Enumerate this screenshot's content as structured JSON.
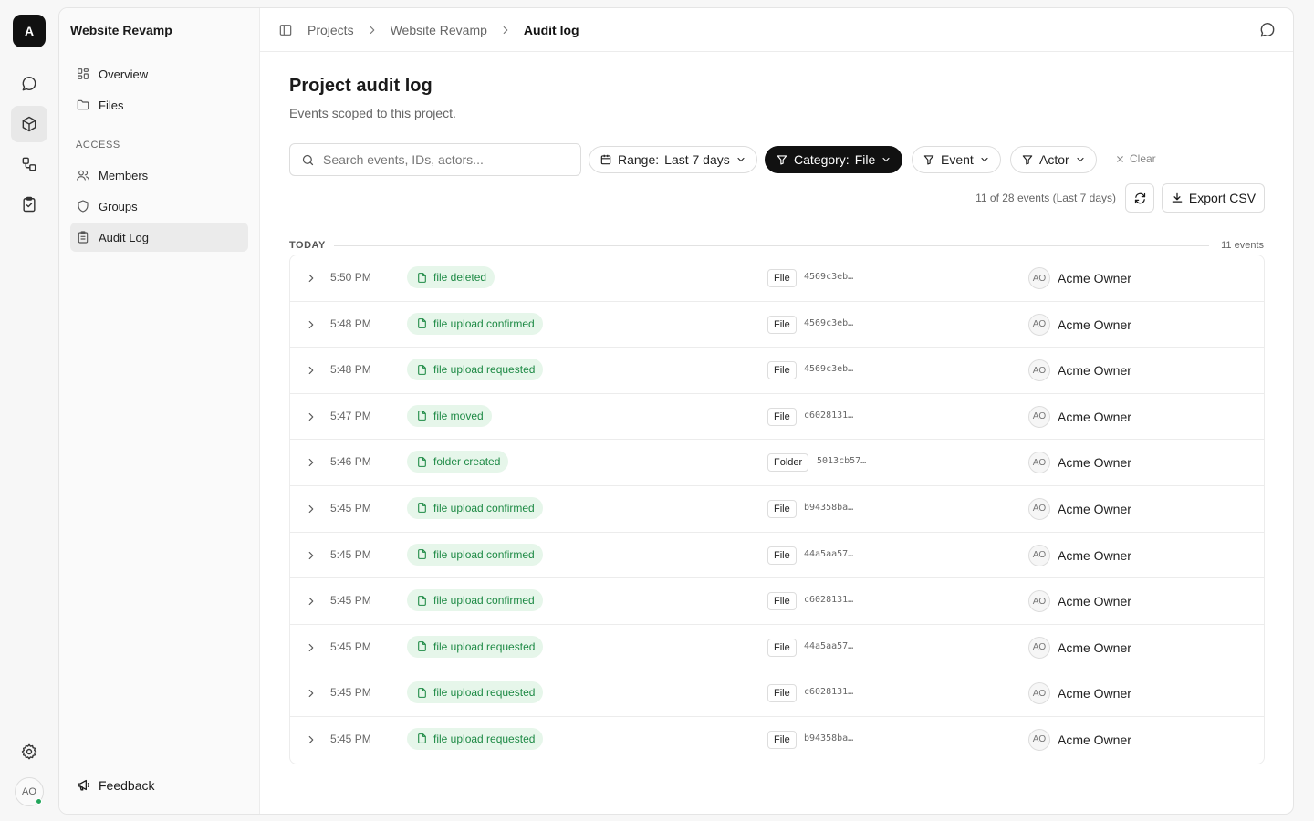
{
  "workspace": {
    "initial": "A"
  },
  "user": {
    "initials": "AO"
  },
  "sidebar": {
    "project_title": "Website Revamp",
    "items": [
      {
        "label": "Overview",
        "icon": "grid-icon"
      },
      {
        "label": "Files",
        "icon": "folder-icon"
      }
    ],
    "section_label": "ACCESS",
    "access_items": [
      {
        "label": "Members",
        "icon": "users-icon"
      },
      {
        "label": "Groups",
        "icon": "shield-icon"
      },
      {
        "label": "Audit Log",
        "icon": "clipboard-icon",
        "active": true
      }
    ],
    "feedback_label": "Feedback"
  },
  "breadcrumb": {
    "items": [
      "Projects",
      "Website Revamp"
    ],
    "current": "Audit log"
  },
  "page": {
    "title": "Project audit log",
    "subtitle": "Events scoped to this project."
  },
  "filters": {
    "search_placeholder": "Search events, IDs, actors...",
    "range": {
      "label": "Range:",
      "value": "Last 7 days"
    },
    "category": {
      "label": "Category:",
      "value": "File"
    },
    "event_label": "Event",
    "actor_label": "Actor",
    "clear_label": "Clear"
  },
  "summary": {
    "count_text": "11 of 28 events (Last 7 days)",
    "export_label": "Export CSV"
  },
  "group": {
    "label": "TODAY",
    "count": "11 events"
  },
  "events": [
    {
      "time": "5:50 PM",
      "event": "file deleted",
      "type": "File",
      "id": "4569c3eb…",
      "actor_initials": "AO",
      "actor": "Acme Owner"
    },
    {
      "time": "5:48 PM",
      "event": "file upload confirmed",
      "type": "File",
      "id": "4569c3eb…",
      "actor_initials": "AO",
      "actor": "Acme Owner"
    },
    {
      "time": "5:48 PM",
      "event": "file upload requested",
      "type": "File",
      "id": "4569c3eb…",
      "actor_initials": "AO",
      "actor": "Acme Owner"
    },
    {
      "time": "5:47 PM",
      "event": "file moved",
      "type": "File",
      "id": "c6028131…",
      "actor_initials": "AO",
      "actor": "Acme Owner"
    },
    {
      "time": "5:46 PM",
      "event": "folder created",
      "type": "Folder",
      "id": "5013cb57…",
      "actor_initials": "AO",
      "actor": "Acme Owner"
    },
    {
      "time": "5:45 PM",
      "event": "file upload confirmed",
      "type": "File",
      "id": "b94358ba…",
      "actor_initials": "AO",
      "actor": "Acme Owner"
    },
    {
      "time": "5:45 PM",
      "event": "file upload confirmed",
      "type": "File",
      "id": "44a5aa57…",
      "actor_initials": "AO",
      "actor": "Acme Owner"
    },
    {
      "time": "5:45 PM",
      "event": "file upload confirmed",
      "type": "File",
      "id": "c6028131…",
      "actor_initials": "AO",
      "actor": "Acme Owner"
    },
    {
      "time": "5:45 PM",
      "event": "file upload requested",
      "type": "File",
      "id": "44a5aa57…",
      "actor_initials": "AO",
      "actor": "Acme Owner"
    },
    {
      "time": "5:45 PM",
      "event": "file upload requested",
      "type": "File",
      "id": "c6028131…",
      "actor_initials": "AO",
      "actor": "Acme Owner"
    },
    {
      "time": "5:45 PM",
      "event": "file upload requested",
      "type": "File",
      "id": "b94358ba…",
      "actor_initials": "AO",
      "actor": "Acme Owner"
    }
  ],
  "colors": {
    "accent_dark": "#111111",
    "event_badge_bg": "#e6f6ea",
    "event_badge_text": "#1e8a45",
    "online": "#22a55b"
  }
}
